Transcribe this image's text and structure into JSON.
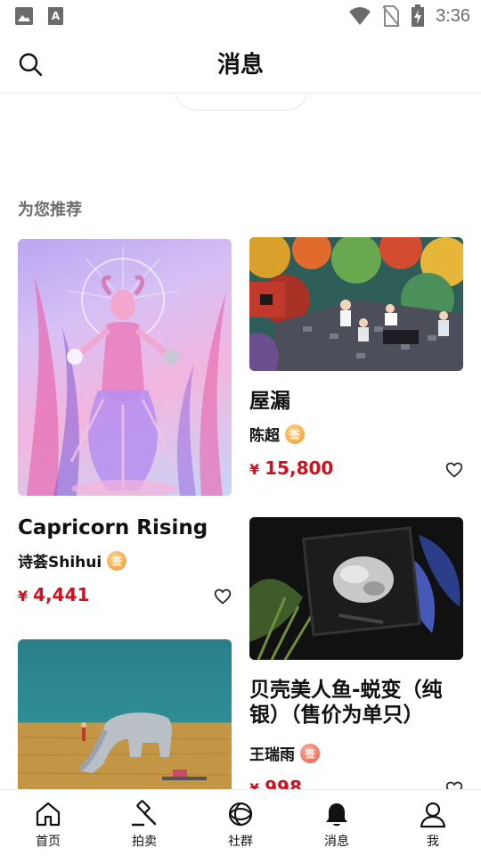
{
  "status_bar": {
    "time": "3:36"
  },
  "header": {
    "title": "消息"
  },
  "section": {
    "title": "为您推荐"
  },
  "cards": [
    {
      "name": "Capricorn Rising",
      "artist": "诗荟Shihui",
      "badge": "签",
      "price_symbol": "¥",
      "price": "4,441"
    },
    {
      "name": "屋漏",
      "artist": "陈超",
      "badge": "签",
      "price_symbol": "¥",
      "price": "15,800"
    },
    {
      "name": "贝壳美人鱼-蜕变（纯银）（售价为单只）",
      "artist": "王瑞雨",
      "badge": "签",
      "price_symbol": "¥",
      "price": "998"
    }
  ],
  "bottom_nav": [
    {
      "label": "首页",
      "icon": "home-icon"
    },
    {
      "label": "拍卖",
      "icon": "auction-hammer-icon"
    },
    {
      "label": "社群",
      "icon": "community-icon"
    },
    {
      "label": "消息",
      "icon": "bell-icon",
      "active": true
    },
    {
      "label": "我",
      "icon": "profile-icon"
    }
  ],
  "colors": {
    "price": "#d0101c",
    "badge": "#f0962c",
    "section_title": "#6e6e6e"
  }
}
